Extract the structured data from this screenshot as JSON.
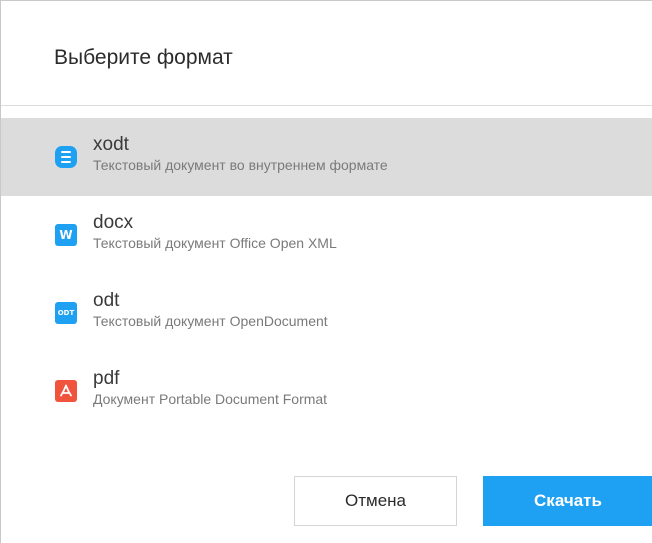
{
  "dialog": {
    "title": "Выберите формат",
    "formats": [
      {
        "name": "xodt",
        "description": "Текстовый документ во внутреннем формате",
        "icon": "document-lines-icon",
        "color": "#1fa1f3",
        "selected": true
      },
      {
        "name": "docx",
        "description": "Текстовый документ Office Open XML",
        "icon": "word-icon",
        "icon_text": "W",
        "color": "#1fa1f3",
        "selected": false
      },
      {
        "name": "odt",
        "description": "Текстовый документ OpenDocument",
        "icon": "odt-icon",
        "icon_text": "ODT",
        "color": "#1fa1f3",
        "selected": false
      },
      {
        "name": "pdf",
        "description": "Документ Portable Document Format",
        "icon": "pdf-icon",
        "color": "#f0543c",
        "selected": false
      }
    ],
    "buttons": {
      "cancel_label": "Отмена",
      "download_label": "Скачать"
    },
    "colors": {
      "accent": "#1fa1f3",
      "selected_bg": "#dcdcdc",
      "pdf": "#f0543c"
    }
  }
}
